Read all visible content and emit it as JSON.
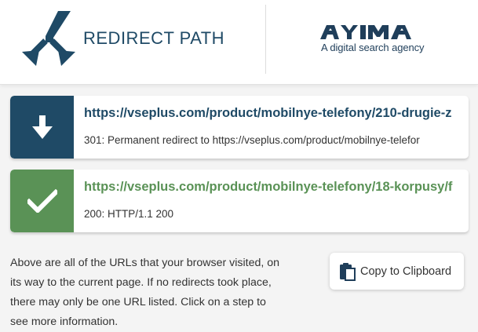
{
  "header": {
    "product_name": "REDIRECT PATH",
    "partner_name": "AYIMA",
    "partner_tagline": "A digital search agency"
  },
  "redirects": [
    {
      "url": "https://vseplus.com/product/mobilnye-telefony/210-drugie-z",
      "status": "301: Permanent redirect to https://vseplus.com/product/mobilnye-telefor",
      "icon": "arrow-down-icon",
      "color": "#1f4a66"
    },
    {
      "url": "https://vseplus.com/product/mobilnye-telefony/18-korpusy/f",
      "status": "200: HTTP/1.1 200",
      "icon": "check-icon",
      "color": "#5a9256"
    }
  ],
  "info": {
    "text": "Above are all of the URLs that your browser visited, on its way to the current page. If no redirects took place, there may only be one URL listed. Click on a step to see more information."
  },
  "actions": {
    "copy_label": "Copy to Clipboard"
  }
}
